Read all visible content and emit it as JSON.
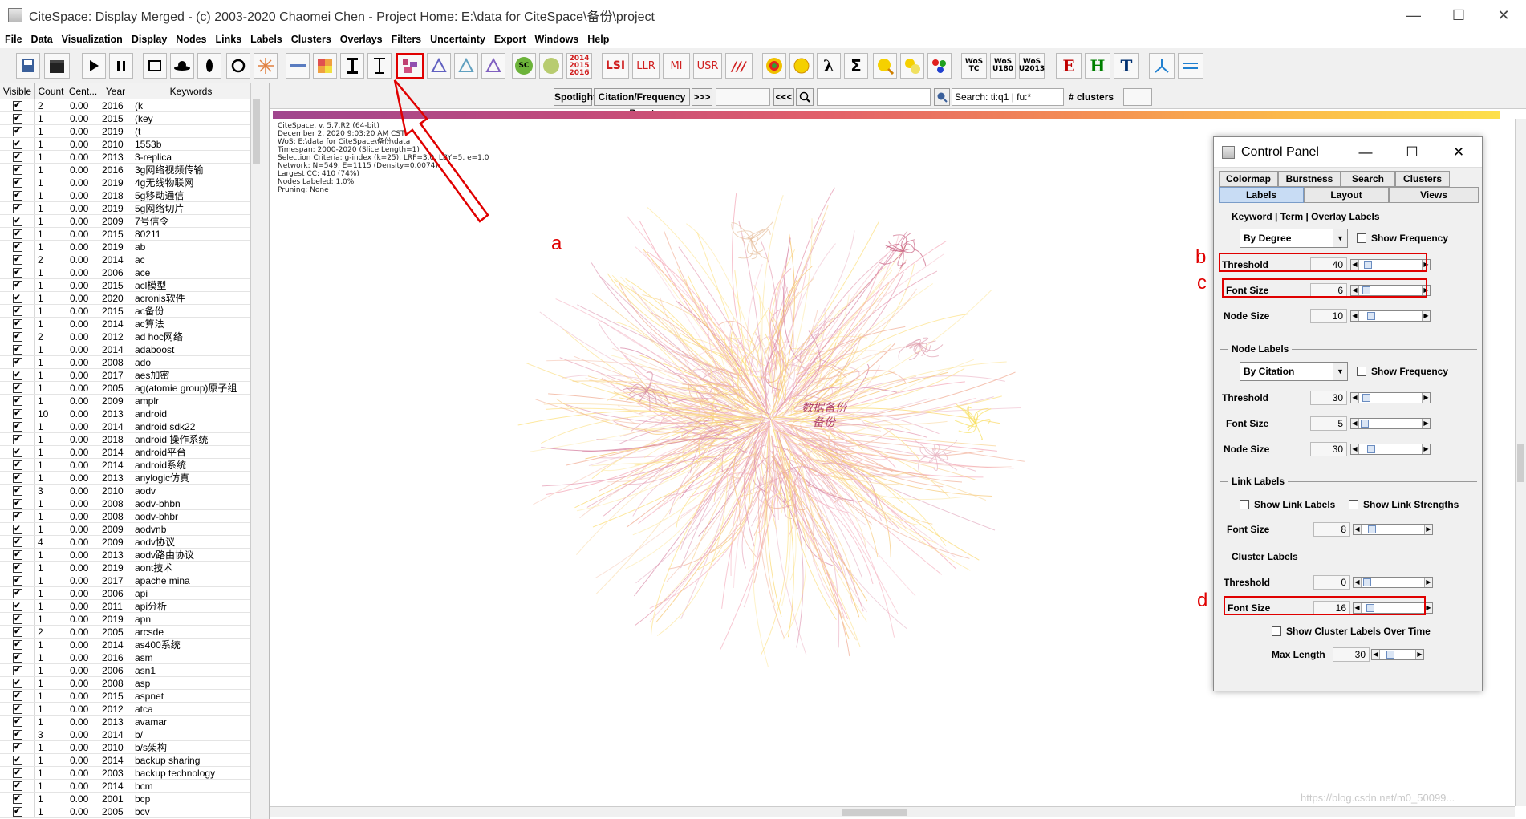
{
  "window": {
    "title": "CiteSpace: Display Merged - (c) 2003-2020 Chaomei Chen - Project Home: E:\\data for CiteSpace\\备份\\project",
    "minimize": "—",
    "maximize": "☐",
    "close": "✕"
  },
  "menu": [
    "File",
    "Data",
    "Visualization",
    "Display",
    "Nodes",
    "Links",
    "Labels",
    "Clusters",
    "Overlays",
    "Filters",
    "Uncertainty",
    "Export",
    "Windows",
    "Help"
  ],
  "toolbar": {
    "lsi": "LSI",
    "llr": "LLR",
    "mi": "MI",
    "usr": "USR",
    "slash": "///",
    "sc": "SC",
    "years": [
      "2014",
      "2015",
      "2016"
    ],
    "wos_tc": [
      "WoS",
      "TC"
    ],
    "wos_u180": [
      "WoS",
      "U180"
    ],
    "wos_u2013": [
      "WoS",
      "U2013"
    ],
    "e": "E",
    "h": "H",
    "t": "T"
  },
  "table": {
    "headers": [
      "Visible",
      "Count",
      "Cent...",
      "Year",
      "Keywords"
    ],
    "rows": [
      [
        "2",
        "0.00",
        "2016",
        "(k"
      ],
      [
        "1",
        "0.00",
        "2015",
        "(key"
      ],
      [
        "1",
        "0.00",
        "2019",
        "(t"
      ],
      [
        "1",
        "0.00",
        "2010",
        "1553b"
      ],
      [
        "1",
        "0.00",
        "2013",
        "3-replica"
      ],
      [
        "1",
        "0.00",
        "2016",
        "3g网络视频传输"
      ],
      [
        "1",
        "0.00",
        "2019",
        "4g无线物联网"
      ],
      [
        "1",
        "0.00",
        "2018",
        "5g移动通信"
      ],
      [
        "1",
        "0.00",
        "2019",
        "5g网络切片"
      ],
      [
        "1",
        "0.00",
        "2009",
        "7号信令"
      ],
      [
        "1",
        "0.00",
        "2015",
        "80211"
      ],
      [
        "1",
        "0.00",
        "2019",
        "ab"
      ],
      [
        "2",
        "0.00",
        "2014",
        "ac"
      ],
      [
        "1",
        "0.00",
        "2006",
        "ace"
      ],
      [
        "1",
        "0.00",
        "2015",
        "acl模型"
      ],
      [
        "1",
        "0.00",
        "2020",
        "acronis软件"
      ],
      [
        "1",
        "0.00",
        "2015",
        "ac备份"
      ],
      [
        "1",
        "0.00",
        "2014",
        "ac算法"
      ],
      [
        "2",
        "0.00",
        "2012",
        "ad hoc网络"
      ],
      [
        "1",
        "0.00",
        "2014",
        "adaboost"
      ],
      [
        "1",
        "0.00",
        "2008",
        "ado"
      ],
      [
        "1",
        "0.00",
        "2017",
        "aes加密"
      ],
      [
        "1",
        "0.00",
        "2005",
        "ag(atomie group)原子组"
      ],
      [
        "1",
        "0.00",
        "2009",
        "amplr"
      ],
      [
        "10",
        "0.00",
        "2013",
        "android"
      ],
      [
        "1",
        "0.00",
        "2014",
        "android sdk22"
      ],
      [
        "1",
        "0.00",
        "2018",
        "android 操作系统"
      ],
      [
        "1",
        "0.00",
        "2014",
        "android平台"
      ],
      [
        "1",
        "0.00",
        "2014",
        "android系统"
      ],
      [
        "1",
        "0.00",
        "2013",
        "anylogic仿真"
      ],
      [
        "3",
        "0.00",
        "2010",
        "aodv"
      ],
      [
        "1",
        "0.00",
        "2008",
        "aodv-bhbn"
      ],
      [
        "1",
        "0.00",
        "2008",
        "aodv-bhbr"
      ],
      [
        "1",
        "0.00",
        "2009",
        "aodvnb"
      ],
      [
        "4",
        "0.00",
        "2009",
        "aodv协议"
      ],
      [
        "1",
        "0.00",
        "2013",
        "aodv路由协议"
      ],
      [
        "1",
        "0.00",
        "2019",
        "aont技术"
      ],
      [
        "1",
        "0.00",
        "2017",
        "apache mina"
      ],
      [
        "1",
        "0.00",
        "2006",
        "api"
      ],
      [
        "1",
        "0.00",
        "2011",
        "api分析"
      ],
      [
        "1",
        "0.00",
        "2019",
        "apn"
      ],
      [
        "2",
        "0.00",
        "2005",
        "arcsde"
      ],
      [
        "1",
        "0.00",
        "2014",
        "as400系统"
      ],
      [
        "1",
        "0.00",
        "2016",
        "asm"
      ],
      [
        "1",
        "0.00",
        "2006",
        "asn1"
      ],
      [
        "1",
        "0.00",
        "2008",
        "asp"
      ],
      [
        "1",
        "0.00",
        "2015",
        "aspnet"
      ],
      [
        "1",
        "0.00",
        "2012",
        "atca"
      ],
      [
        "1",
        "0.00",
        "2013",
        "avamar"
      ],
      [
        "3",
        "0.00",
        "2014",
        "b/"
      ],
      [
        "1",
        "0.00",
        "2010",
        "b/s架构"
      ],
      [
        "1",
        "0.00",
        "2014",
        "backup sharing"
      ],
      [
        "1",
        "0.00",
        "2003",
        "backup technology"
      ],
      [
        "1",
        "0.00",
        "2014",
        "bcm"
      ],
      [
        "1",
        "0.00",
        "2001",
        "bcp"
      ],
      [
        "1",
        "0.00",
        "2005",
        "bcv"
      ]
    ]
  },
  "viz": {
    "spotlight": "Spotlight",
    "burst": "Citation/Frequency Burst",
    "next": ">>>",
    "prev": "<<<",
    "search": "Search: ti:q1 | fu:*",
    "clusters": "# clusters",
    "info": [
      "CiteSpace, v. 5.7.R2 (64-bit)",
      "December 2, 2020 9:03:20 AM CST",
      "WoS: E:\\data for CiteSpace\\备份\\data",
      "Timespan: 2000-2020 (Slice Length=1)",
      "Selection Criteria: g-index (k=25), LRF=3.0, LBY=5, e=1.0",
      "Network: N=549, E=1115 (Density=0.0074)",
      "Largest CC: 410 (74%)",
      "Nodes Labeled: 1.0%",
      "Pruning: None"
    ],
    "label1": "数据备份",
    "label2": "备份",
    "watermark": "https://blog.csdn.net/m0_50099...",
    "annotation_a": "a"
  },
  "control_panel": {
    "title": "Control Panel",
    "tabs_top": [
      "Colormap",
      "Burstness",
      "Search",
      "Clusters"
    ],
    "tabs_bottom": [
      "Labels",
      "Layout",
      "Views"
    ],
    "keyword": {
      "legend": "Keyword | Term | Overlay Labels",
      "by": "By Degree",
      "show_freq": "Show Frequency",
      "threshold_label": "Threshold",
      "threshold": "40",
      "font_label": "Font Size",
      "font": "6",
      "node_label": "Node Size",
      "node": "10"
    },
    "node": {
      "legend": "Node Labels",
      "by": "By Citation",
      "show_freq": "Show Frequency",
      "threshold_label": "Threshold",
      "threshold": "30",
      "font_label": "Font Size",
      "font": "5",
      "node_label": "Node Size",
      "node": "30"
    },
    "link": {
      "legend": "Link Labels",
      "show_labels": "Show Link Labels",
      "show_strengths": "Show Link Strengths",
      "font_label": "Font Size",
      "font": "8"
    },
    "cluster": {
      "legend": "Cluster Labels",
      "threshold_label": "Threshold",
      "threshold": "0",
      "font_label": "Font Size",
      "font": "16",
      "over_time": "Show Cluster Labels Over Time",
      "max_label": "Max Length",
      "max": "30"
    },
    "annotations": [
      "b",
      "c",
      "d"
    ]
  }
}
